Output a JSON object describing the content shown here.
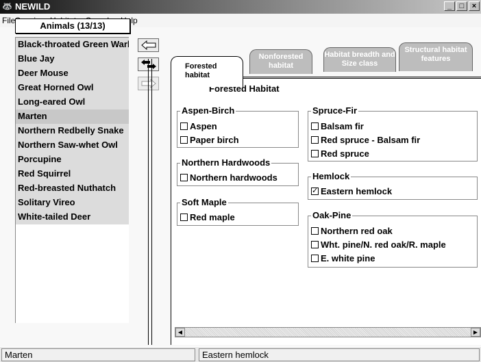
{
  "window": {
    "title": "NEWILD"
  },
  "menu": [
    "File",
    "Species",
    "Habitat",
    "Search",
    "Help"
  ],
  "animals": {
    "header": "Animals (13/13)",
    "items": [
      "Black-throated Green Warbler",
      "Blue Jay",
      "Deer Mouse",
      "Great Horned Owl",
      "Long-eared Owl",
      "Marten",
      "Northern Redbelly Snake",
      "Northern Saw-whet Owl",
      "Porcupine",
      "Red Squirrel",
      "Red-breasted Nuthatch",
      "Solitary Vireo",
      "White-tailed Deer"
    ]
  },
  "tabs": {
    "forested": "Forested habitat",
    "nonforested": "Nonforested habitat",
    "breadth": "Habitat breadth and Size class",
    "structural": "Structural habitat features"
  },
  "panel": {
    "title": "Forested Habitat",
    "groups": {
      "aspen_birch": {
        "label": "Aspen-Birch",
        "items": [
          "Aspen",
          "Paper birch"
        ]
      },
      "northern_hardwoods": {
        "label": "Northern Hardwoods",
        "items": [
          "Northern hardwoods"
        ]
      },
      "soft_maple": {
        "label": "Soft Maple",
        "items": [
          "Red maple"
        ]
      },
      "spruce_fir": {
        "label": "Spruce-Fir",
        "items": [
          "Balsam fir",
          "Red spruce - Balsam fir",
          "Red spruce"
        ]
      },
      "hemlock": {
        "label": "Hemlock",
        "items": [
          "Eastern hemlock"
        ],
        "checked": [
          true
        ]
      },
      "oak_pine": {
        "label": "Oak-Pine",
        "items": [
          "Northern red oak",
          "Wht. pine/N. red oak/R. maple",
          "E. white pine"
        ]
      }
    }
  },
  "status": {
    "left": "Marten",
    "right": "Eastern hemlock"
  },
  "icons": {
    "app": "raccoon-icon",
    "arrow_left": "arrow-left-icon",
    "swap": "swap-arrows-icon",
    "arrow_right": "arrow-right-icon",
    "scroll_left": "scroll-left-icon",
    "scroll_right": "scroll-right-icon"
  }
}
